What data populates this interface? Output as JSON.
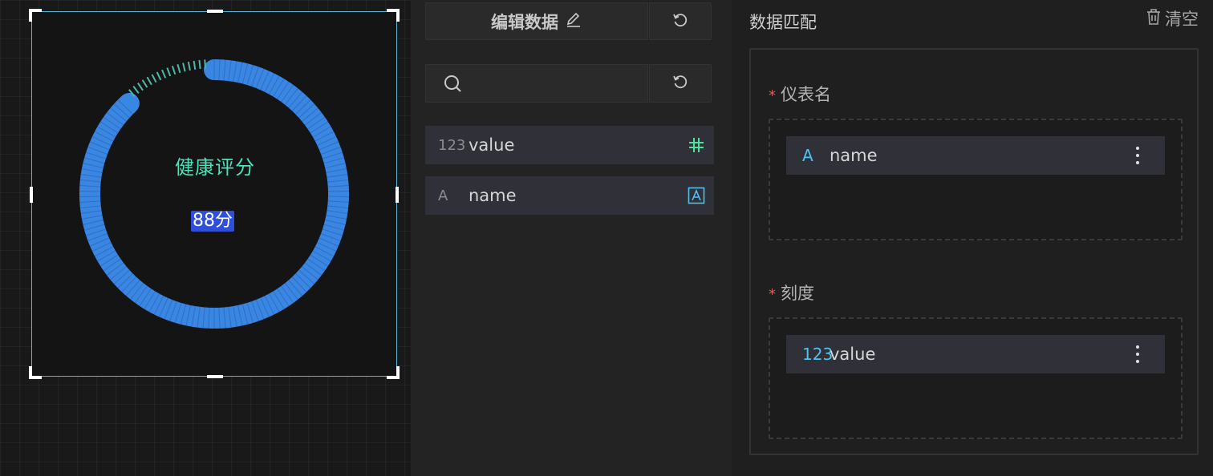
{
  "canvas": {
    "gauge": {
      "title": "健康评分",
      "value_label": "88分",
      "value": 88,
      "max": 100,
      "colors": {
        "arc": "#3a86e3",
        "ticks": "#4fb8a8",
        "title": "#4fe0b8",
        "value_bg": "#2f4fd8"
      }
    }
  },
  "fields_panel": {
    "edit_button_label": "编辑数据",
    "search": {
      "value": "",
      "placeholder": ""
    },
    "fields": [
      {
        "type_label": "123",
        "name": "value",
        "type_icon": "number-icon",
        "action_icon": "hash-icon"
      },
      {
        "type_label": "A",
        "name": "name",
        "type_icon": "text-icon",
        "action_icon": "text-box-icon"
      }
    ]
  },
  "mapping_panel": {
    "title": "数据匹配",
    "clear_label": "清空",
    "sections": [
      {
        "label": "仪表名",
        "required": "*",
        "field": {
          "type_label": "A",
          "name": "name"
        }
      },
      {
        "label": "刻度",
        "required": "*",
        "field": {
          "type_label": "123",
          "name": "value"
        }
      }
    ]
  }
}
